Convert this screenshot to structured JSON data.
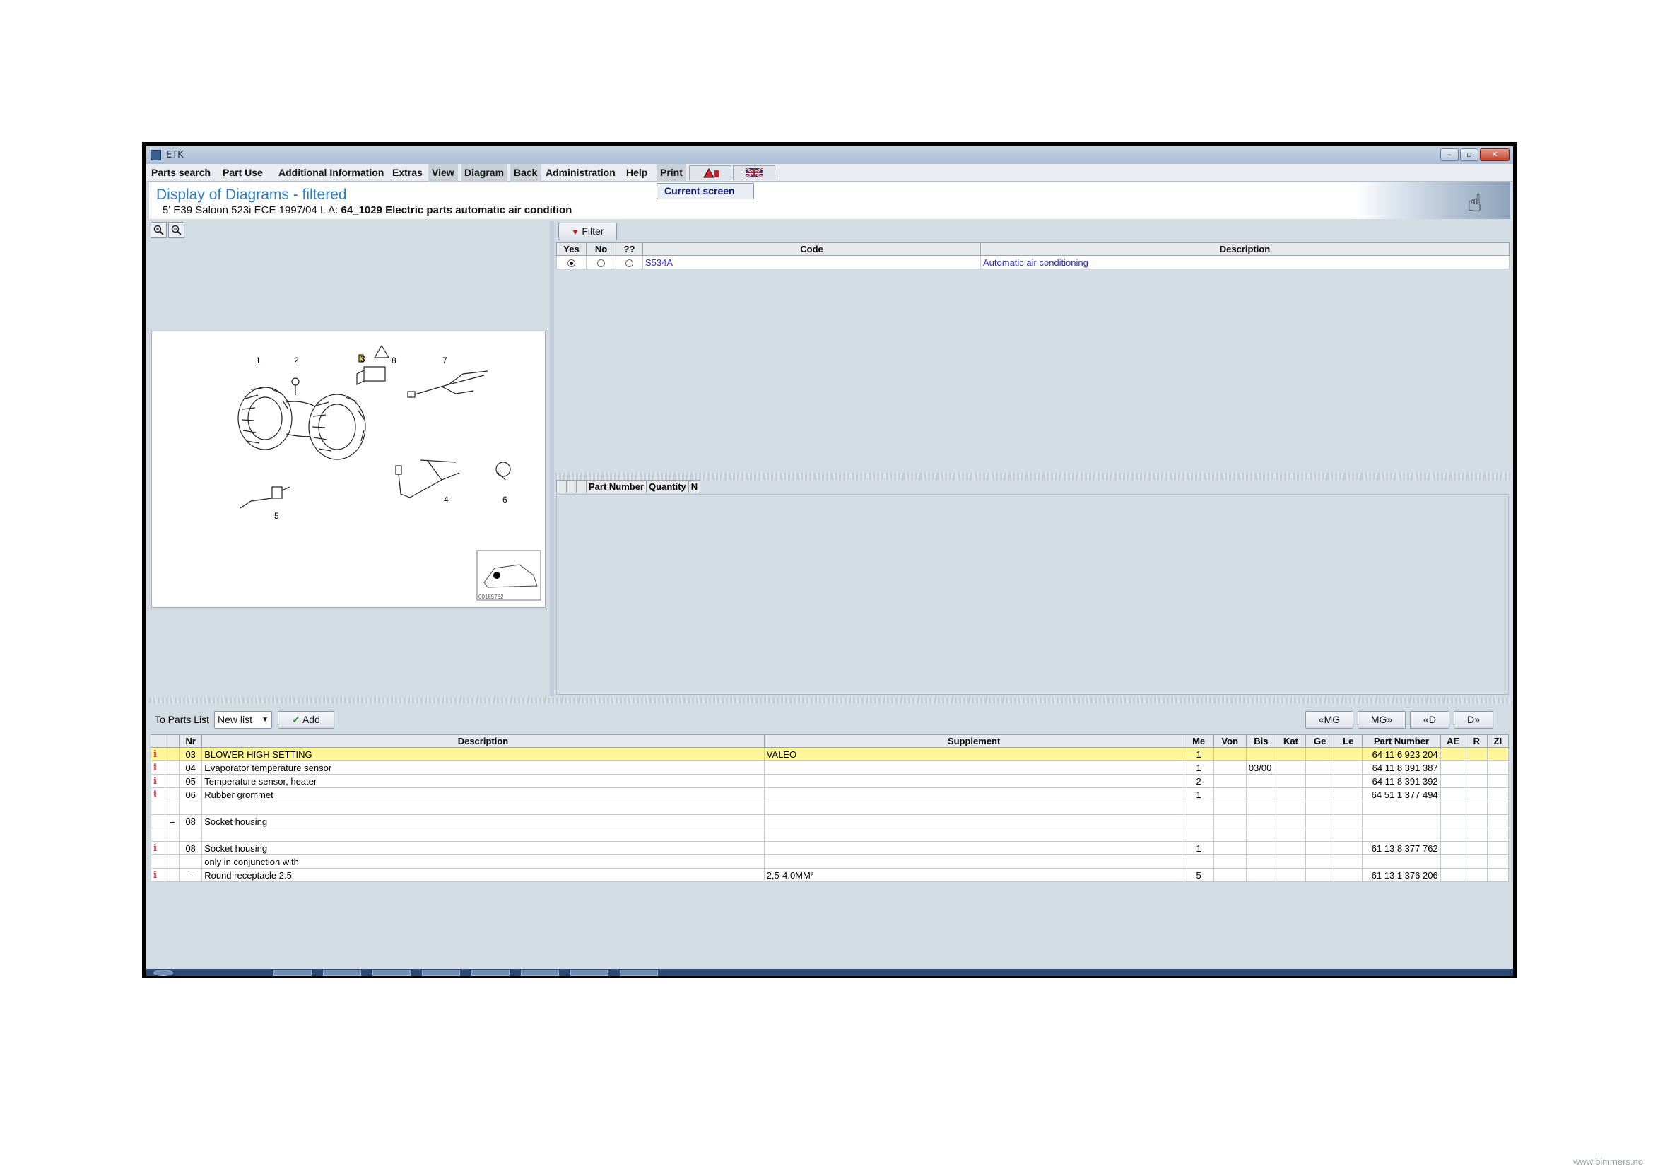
{
  "window": {
    "title": "ETK"
  },
  "menu": {
    "items": [
      "Parts search",
      "Part Use",
      "Additional Information",
      "Extras",
      "View",
      "Diagram",
      "Back",
      "Administration",
      "Help",
      "Print"
    ],
    "print_dropdown": [
      "Current screen"
    ]
  },
  "header": {
    "title": "Display of Diagrams - filtered",
    "subtitle_prefix": "5' E39 Saloon 523i ECE 1997/04 L A: ",
    "subtitle_bold": "64_1029 Electric parts automatic air condition"
  },
  "diagram": {
    "callouts": [
      "1",
      "2",
      "3",
      "7",
      "8",
      "4",
      "5",
      "6"
    ],
    "thumb_code": "00165762"
  },
  "filter": {
    "button_label": "Filter",
    "columns": [
      "Yes",
      "No",
      "??",
      "Code",
      "Description"
    ],
    "rows": [
      {
        "selected": "Yes",
        "code": "S534A",
        "description": "Automatic air conditioning"
      }
    ]
  },
  "partnum_table": {
    "columns": [
      "",
      "",
      "",
      "Part Number",
      "Quantity",
      "N"
    ]
  },
  "parts_list_bar": {
    "label": "To Parts List",
    "select_value": "New list",
    "add_label": "Add",
    "nav": [
      "«MG",
      "MG»",
      "«D",
      "D»"
    ]
  },
  "parts": {
    "columns": [
      "",
      "",
      "Nr",
      "Description",
      "Supplement",
      "Me",
      "Von",
      "Bis",
      "Kat",
      "Ge",
      "Le",
      "Part Number",
      "AE",
      "R",
      "ZI"
    ],
    "rows": [
      {
        "info": "i",
        "mark": "",
        "nr": "03",
        "description": "BLOWER HIGH SETTING",
        "supplement": "VALEO",
        "me": "1",
        "von": "",
        "bis": "",
        "part_number": "64 11 6 923 204",
        "highlight": true
      },
      {
        "info": "i",
        "mark": "",
        "nr": "04",
        "description": "Evaporator temperature sensor",
        "supplement": "",
        "me": "1",
        "von": "",
        "bis": "03/00",
        "part_number": "64 11 8 391 387",
        "highlight": false
      },
      {
        "info": "i",
        "mark": "",
        "nr": "05",
        "description": "Temperature sensor, heater",
        "supplement": "",
        "me": "2",
        "von": "",
        "bis": "",
        "part_number": "64 11 8 391 392",
        "highlight": false
      },
      {
        "info": "i",
        "mark": "",
        "nr": "06",
        "description": "Rubber grommet",
        "supplement": "",
        "me": "1",
        "von": "",
        "bis": "",
        "part_number": "64 51 1 377 494",
        "highlight": false
      },
      {
        "info": "",
        "mark": "",
        "nr": "",
        "description": "",
        "supplement": "",
        "me": "",
        "von": "",
        "bis": "",
        "part_number": "",
        "highlight": false
      },
      {
        "info": "",
        "mark": "–",
        "nr": "08",
        "description": "Socket housing",
        "supplement": "",
        "me": "",
        "von": "",
        "bis": "",
        "part_number": "",
        "highlight": false
      },
      {
        "info": "",
        "mark": "",
        "nr": "",
        "description": "",
        "supplement": "",
        "me": "",
        "von": "",
        "bis": "",
        "part_number": "",
        "highlight": false
      },
      {
        "info": "i",
        "mark": "",
        "nr": "08",
        "description": "Socket housing",
        "supplement": "",
        "me": "1",
        "von": "",
        "bis": "",
        "part_number": "61 13 8 377 762",
        "highlight": false
      },
      {
        "info": "",
        "mark": "",
        "nr": "",
        "description": "only in conjunction with",
        "supplement": "",
        "me": "",
        "von": "",
        "bis": "",
        "part_number": "",
        "highlight": false
      },
      {
        "info": "i",
        "mark": "",
        "nr": "--",
        "description": "Round receptacle 2.5",
        "supplement": "2,5-4,0MM²",
        "me": "5",
        "von": "",
        "bis": "",
        "part_number": "61 13 1 376 206",
        "highlight": false
      }
    ]
  },
  "watermark": "www.bimmers.no",
  "colors": {
    "title_blue": "#2f7fc6",
    "highlight_yellow": "#fff79a",
    "info_red": "#c4141a",
    "link_blue": "#2b2bd6"
  }
}
